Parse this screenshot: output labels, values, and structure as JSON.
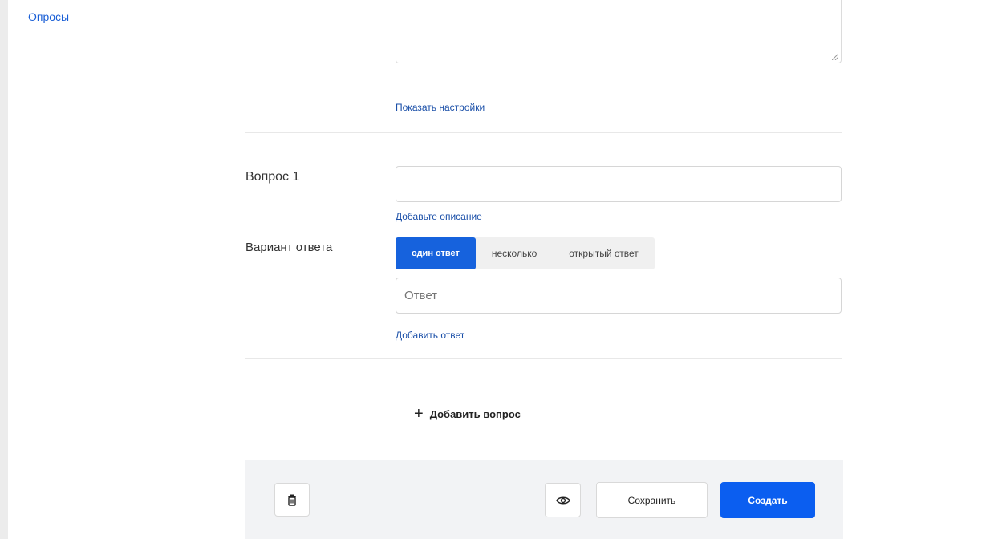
{
  "sidebar": {
    "polls_link": "Опросы"
  },
  "settings": {
    "show_settings_link": "Показать настройки"
  },
  "question": {
    "label": "Вопрос 1",
    "title_value": "",
    "add_description_link": "Добавьте описание",
    "answer_type_label": "Вариант ответа",
    "answer_types": [
      "один ответ",
      "несколько",
      "открытый ответ"
    ],
    "selected_answer_type": "один ответ",
    "answer_placeholder": "Ответ",
    "add_answer_link": "Добавить ответ"
  },
  "add_question_label": "Добавить вопрос",
  "footer": {
    "save_label": "Сохранить",
    "create_label": "Создать",
    "icons": {
      "delete": "trash-icon",
      "preview": "eye-icon"
    }
  },
  "colors": {
    "accent": "#0b5ef0",
    "link": "#1a4fa8"
  }
}
